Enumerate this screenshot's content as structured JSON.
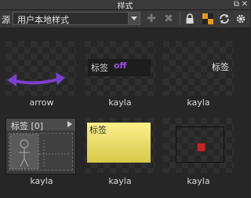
{
  "window": {
    "title": "样式"
  },
  "toolbar": {
    "source_label": "源",
    "selected_style": "用户本地样式",
    "tool_icons": [
      "add-icon",
      "delete-icon",
      "lock-icon",
      "checker-icon",
      "refresh-icon",
      "settings-icon"
    ]
  },
  "tiles": [
    {
      "caption": "arrow"
    },
    {
      "caption": "kayla",
      "preview_text": "标签",
      "state_text": "off"
    },
    {
      "caption": "kayla",
      "preview_text": "标签"
    },
    {
      "caption": "kayla",
      "preview_text": "标签 [0]"
    },
    {
      "caption": "kayla",
      "preview_text": "标签"
    },
    {
      "caption": "kayla"
    }
  ],
  "colors": {
    "accent_purple": "#7b3fd0",
    "off_text": "#9b4fe0",
    "yellow": "#f2e468",
    "red": "#c02828"
  }
}
